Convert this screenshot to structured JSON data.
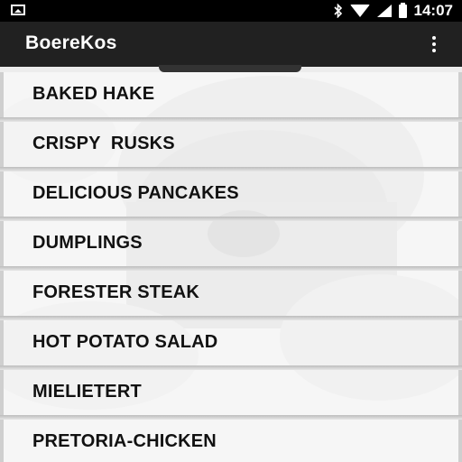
{
  "status_bar": {
    "time": "14:07",
    "icons": [
      "image-notification-icon",
      "bluetooth-icon",
      "wifi-icon",
      "signal-icon",
      "battery-icon"
    ]
  },
  "app_bar": {
    "title": "BoereKos",
    "menu_icon": "overflow-menu-icon"
  },
  "recipes": [
    "BAKED HAKE",
    "CRISPY  RUSKS",
    "DELICIOUS PANCAKES",
    "DUMPLINGS",
    "FORESTER STEAK",
    "HOT POTATO SALAD",
    "MIELIETERT",
    "PRETORIA-CHICKEN"
  ],
  "colors": {
    "status_bar": "#000000",
    "app_bar": "#212121",
    "text": "#111111"
  }
}
